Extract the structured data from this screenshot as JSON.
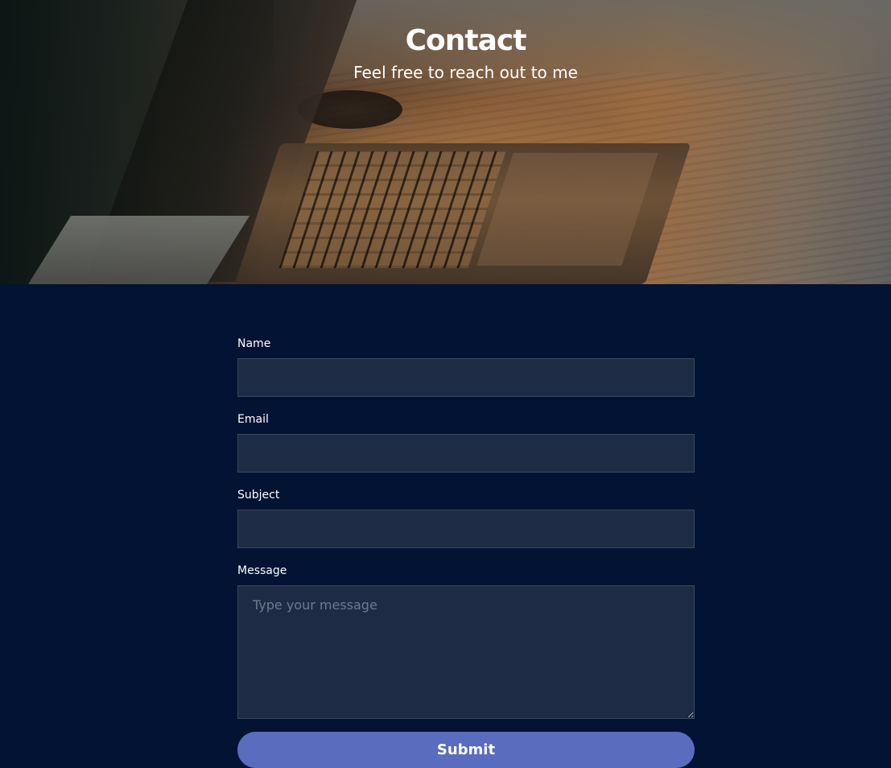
{
  "hero": {
    "title": "Contact",
    "subtitle": "Feel free to reach out to me"
  },
  "form": {
    "name": {
      "label": "Name",
      "value": ""
    },
    "email": {
      "label": "Email",
      "value": ""
    },
    "subject": {
      "label": "Subject",
      "value": ""
    },
    "message": {
      "label": "Message",
      "value": "",
      "placeholder": "Type your message"
    },
    "submit_label": "Submit"
  },
  "colors": {
    "page_background": "#021333",
    "input_background": "#1e2b44",
    "input_border": "#3a4960",
    "button_background": "#596cbd",
    "text": "#ffffff"
  }
}
